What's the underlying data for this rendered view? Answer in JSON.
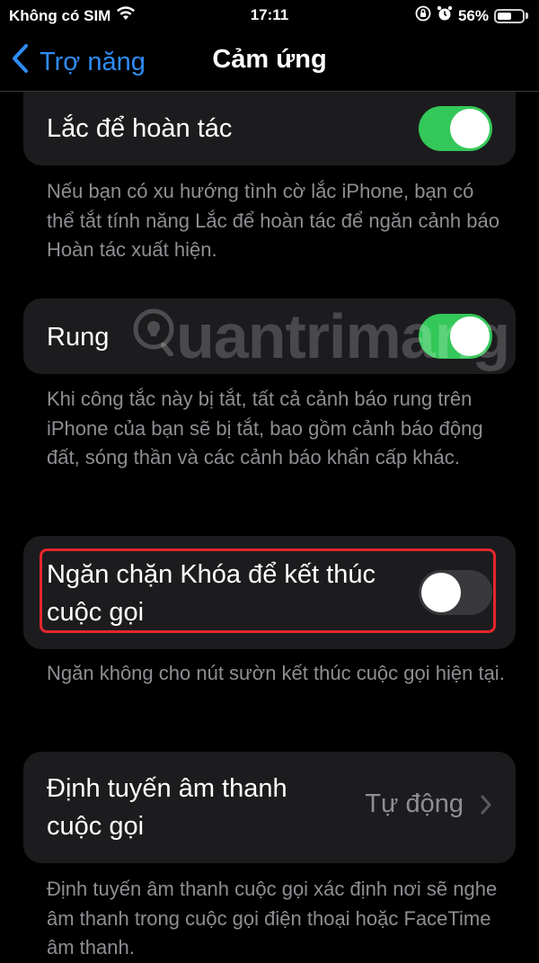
{
  "status_bar": {
    "carrier": "Không có SIM",
    "time": "17:11",
    "battery": "56%",
    "icons": [
      "wifi-icon",
      "orientation-lock-icon",
      "alarm-icon",
      "battery-icon"
    ],
    "battery_level": 0.56
  },
  "nav": {
    "back_label": "Trợ năng",
    "title": "Cảm ứng"
  },
  "settings": [
    {
      "label": "Lắc để hoàn tác",
      "control": "toggle",
      "on": true,
      "footer": "Nếu bạn có xu hướng tình cờ lắc iPhone, bạn có thể tắt tính năng Lắc để hoàn tác để ngăn cảnh báo Hoàn tác xuất hiện."
    },
    {
      "label": "Rung",
      "control": "toggle",
      "on": true,
      "footer": "Khi công tắc này bị tắt, tất cả cảnh báo rung trên iPhone của bạn sẽ bị tắt, bao gồm cảnh báo động đất, sóng thần và các cảnh báo khẩn cấp khác."
    },
    {
      "label": "Ngăn chặn Khóa để kết thúc cuộc gọi",
      "control": "toggle",
      "on": false,
      "highlighted": true,
      "footer": "Ngăn không cho nút sườn kết thúc cuộc gọi hiện tại."
    },
    {
      "label": "Định tuyến âm thanh cuộc gọi",
      "control": "disclosure",
      "value": "Tự động",
      "footer": "Định tuyến âm thanh cuộc gọi xác định nơi sẽ nghe âm thanh trong cuộc gọi điện thoại hoặc FaceTime âm thanh."
    }
  ],
  "colors": {
    "accent": "#2f8cf6",
    "toggle_on": "#34c759",
    "highlight_border": "#e5262d"
  },
  "watermark": "uantrimang"
}
